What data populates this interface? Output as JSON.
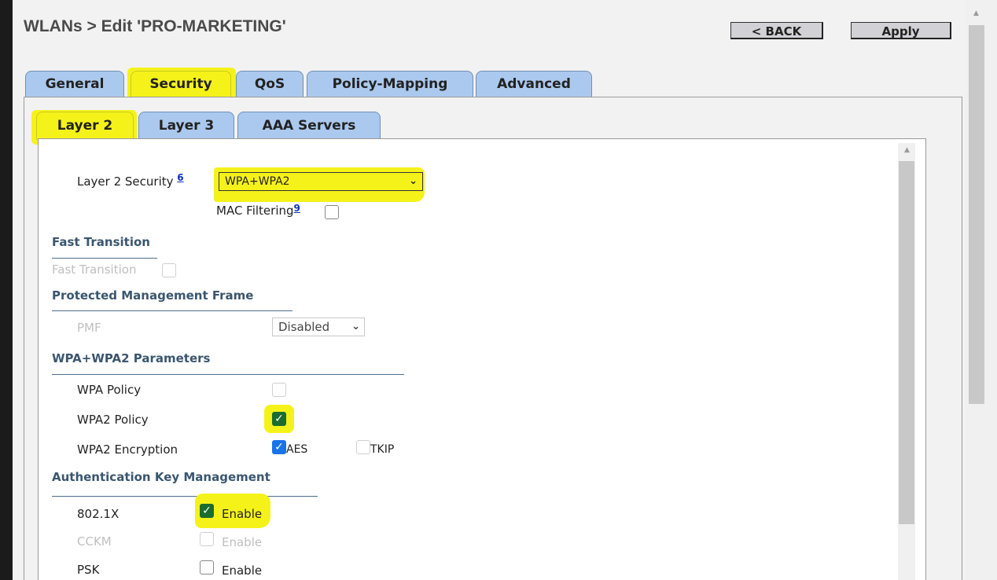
{
  "header": {
    "title": "WLANs > Edit  'PRO-MARKETING'",
    "back_label": "< BACK",
    "apply_label": "Apply"
  },
  "tabs": [
    {
      "label": "General"
    },
    {
      "label": "Security"
    },
    {
      "label": "QoS"
    },
    {
      "label": "Policy-Mapping"
    },
    {
      "label": "Advanced"
    }
  ],
  "subtabs": [
    {
      "label": "Layer 2"
    },
    {
      "label": "Layer 3"
    },
    {
      "label": "AAA Servers"
    }
  ],
  "layer2": {
    "security_label": "Layer 2 Security ",
    "security_link": "6",
    "security_value": "WPA+WPA2",
    "mac_filtering_label": "MAC Filtering",
    "mac_filtering_link": "9"
  },
  "fast_transition": {
    "heading": "Fast Transition",
    "label": "Fast Transition"
  },
  "pmf": {
    "heading": "Protected Management Frame",
    "label": "PMF",
    "value": "Disabled"
  },
  "wpa_params": {
    "heading": "WPA+WPA2 Parameters",
    "wpa_policy_label": "WPA Policy",
    "wpa2_policy_label": "WPA2 Policy",
    "wpa2_encryption_label": "WPA2 Encryption",
    "aes_label": "AES",
    "tkip_label": "TKIP"
  },
  "akm": {
    "heading": "Authentication Key Management",
    "rows": [
      {
        "label": "802.1X",
        "option": "Enable"
      },
      {
        "label": "CCKM",
        "option": "Enable"
      },
      {
        "label": "PSK",
        "option": "Enable"
      }
    ]
  },
  "icons": {
    "dropdown": "chevron-down-icon",
    "checkmark": "check-icon",
    "scroll_up": "scroll-up-arrow-icon"
  },
  "colors": {
    "highlight": "#f5f21a",
    "tab_bg": "#abc9ee",
    "section_heading": "#3a566f",
    "checkbox_checked_blue": "#1a73e8",
    "checkbox_checked_green": "#1a6d2f"
  }
}
